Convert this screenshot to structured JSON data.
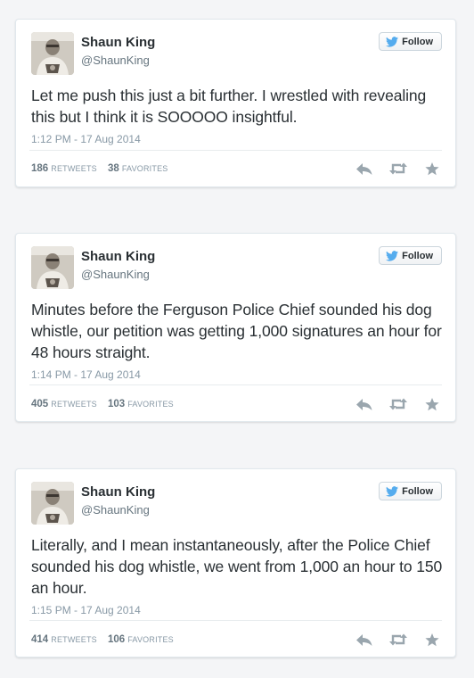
{
  "colors": {
    "background": "#f4f5f7",
    "card": "#ffffff",
    "twitter_blue": "#55acee",
    "muted_text": "#8899a6",
    "action_icons": "#9aa6ae"
  },
  "tweets": [
    {
      "name": "Shaun King",
      "handle": "@ShaunKing",
      "follow_label": "Follow",
      "text": "Let me push this just a bit further. I wrestled with revealing this but I think it is SOOOOO insightful.",
      "timestamp": "1:12 PM - 17 Aug 2014",
      "retweets": "186",
      "retweets_label": "RETWEETS",
      "favorites": "38",
      "favorites_label": "FAVORITES",
      "icons": [
        "reply-icon",
        "retweet-icon",
        "favorite-star-icon"
      ]
    },
    {
      "name": "Shaun King",
      "handle": "@ShaunKing",
      "follow_label": "Follow",
      "text": "Minutes before the Ferguson Police Chief sounded his dog whistle, our petition was getting 1,000 signatures an hour for 48 hours straight.",
      "timestamp": "1:14 PM - 17 Aug 2014",
      "retweets": "405",
      "retweets_label": "RETWEETS",
      "favorites": "103",
      "favorites_label": "FAVORITES",
      "icons": [
        "reply-icon",
        "retweet-icon",
        "favorite-star-icon"
      ]
    },
    {
      "name": "Shaun King",
      "handle": "@ShaunKing",
      "follow_label": "Follow",
      "text": "Literally, and I mean instantaneously, after the Police Chief sounded his dog whistle, we went from 1,000 an hour to 150 an hour.",
      "timestamp": "1:15 PM - 17 Aug 2014",
      "retweets": "414",
      "retweets_label": "RETWEETS",
      "favorites": "106",
      "favorites_label": "FAVORITES",
      "icons": [
        "reply-icon",
        "retweet-icon",
        "favorite-star-icon"
      ]
    }
  ]
}
